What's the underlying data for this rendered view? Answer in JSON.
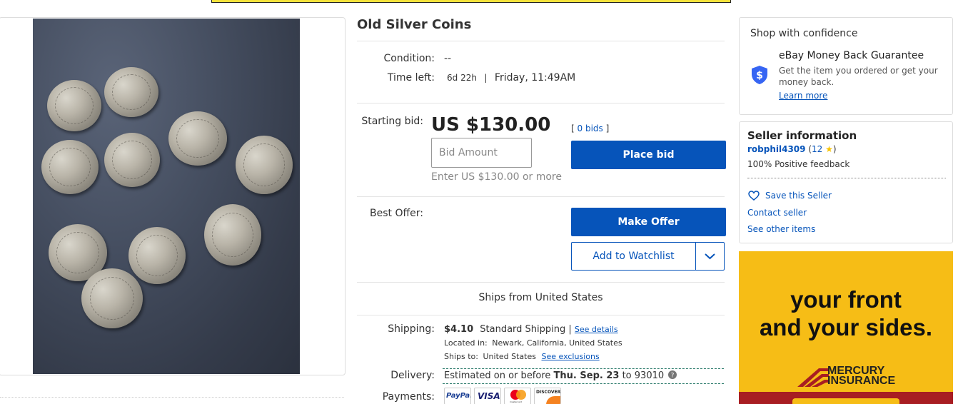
{
  "listing": {
    "title": "Old Silver Coins",
    "condition_label": "Condition:",
    "condition_value": "--",
    "time_left_label": "Time left:",
    "time_left_value": "6d 22h",
    "time_end": "Friday, 11:49AM",
    "starting_bid_label": "Starting bid:",
    "price": "US $130.00",
    "bids_count": "0 bids",
    "bid_placeholder": "Bid Amount",
    "bid_hint": "Enter US $130.00 or more",
    "place_bid_label": "Place bid",
    "best_offer_label": "Best Offer:",
    "make_offer_label": "Make Offer",
    "watchlist_label": "Add to Watchlist",
    "ships_from": "Ships from United States"
  },
  "shipping": {
    "shipping_label": "Shipping:",
    "cost": "$4.10",
    "service": "Standard Shipping",
    "details_link": "See details",
    "located_label": "Located in:",
    "located_value": "Newark, California, United States",
    "ships_to_label": "Ships to:",
    "ships_to_value": "United States",
    "exclusions_link": "See exclusions",
    "delivery_label": "Delivery:",
    "delivery_prefix": "Estimated on or before",
    "delivery_date": "Thu. Sep. 23",
    "delivery_to": "to",
    "delivery_zip": "93010",
    "payments_label": "Payments:",
    "payment_methods": [
      "PayPal",
      "VISA",
      "mastercard",
      "DISCOVER"
    ]
  },
  "confidence": {
    "heading": "Shop with confidence",
    "guarantee_title": "eBay Money Back Guarantee",
    "guarantee_desc": "Get the item you ordered or get your money back.",
    "learn_more": "Learn more"
  },
  "seller": {
    "heading": "Seller information",
    "name": "robphil4309",
    "feedback_score": "12",
    "positive": "100% Positive feedback",
    "save_seller": "Save this Seller",
    "contact": "Contact seller",
    "other_items": "See other items"
  },
  "ad": {
    "headline_line1": "your front",
    "headline_line2": "and your sides.",
    "brand_line1": "MERCURY",
    "brand_line2": "INSURANCE"
  },
  "colors": {
    "accent_blue": "#0654ba",
    "ad_yellow": "#f6bd16",
    "ad_red": "#a81d22",
    "star": "#f7c300"
  },
  "icons": [
    "shield-dollar-icon",
    "star-icon",
    "heart-icon",
    "chevron-down-icon",
    "help-icon"
  ]
}
